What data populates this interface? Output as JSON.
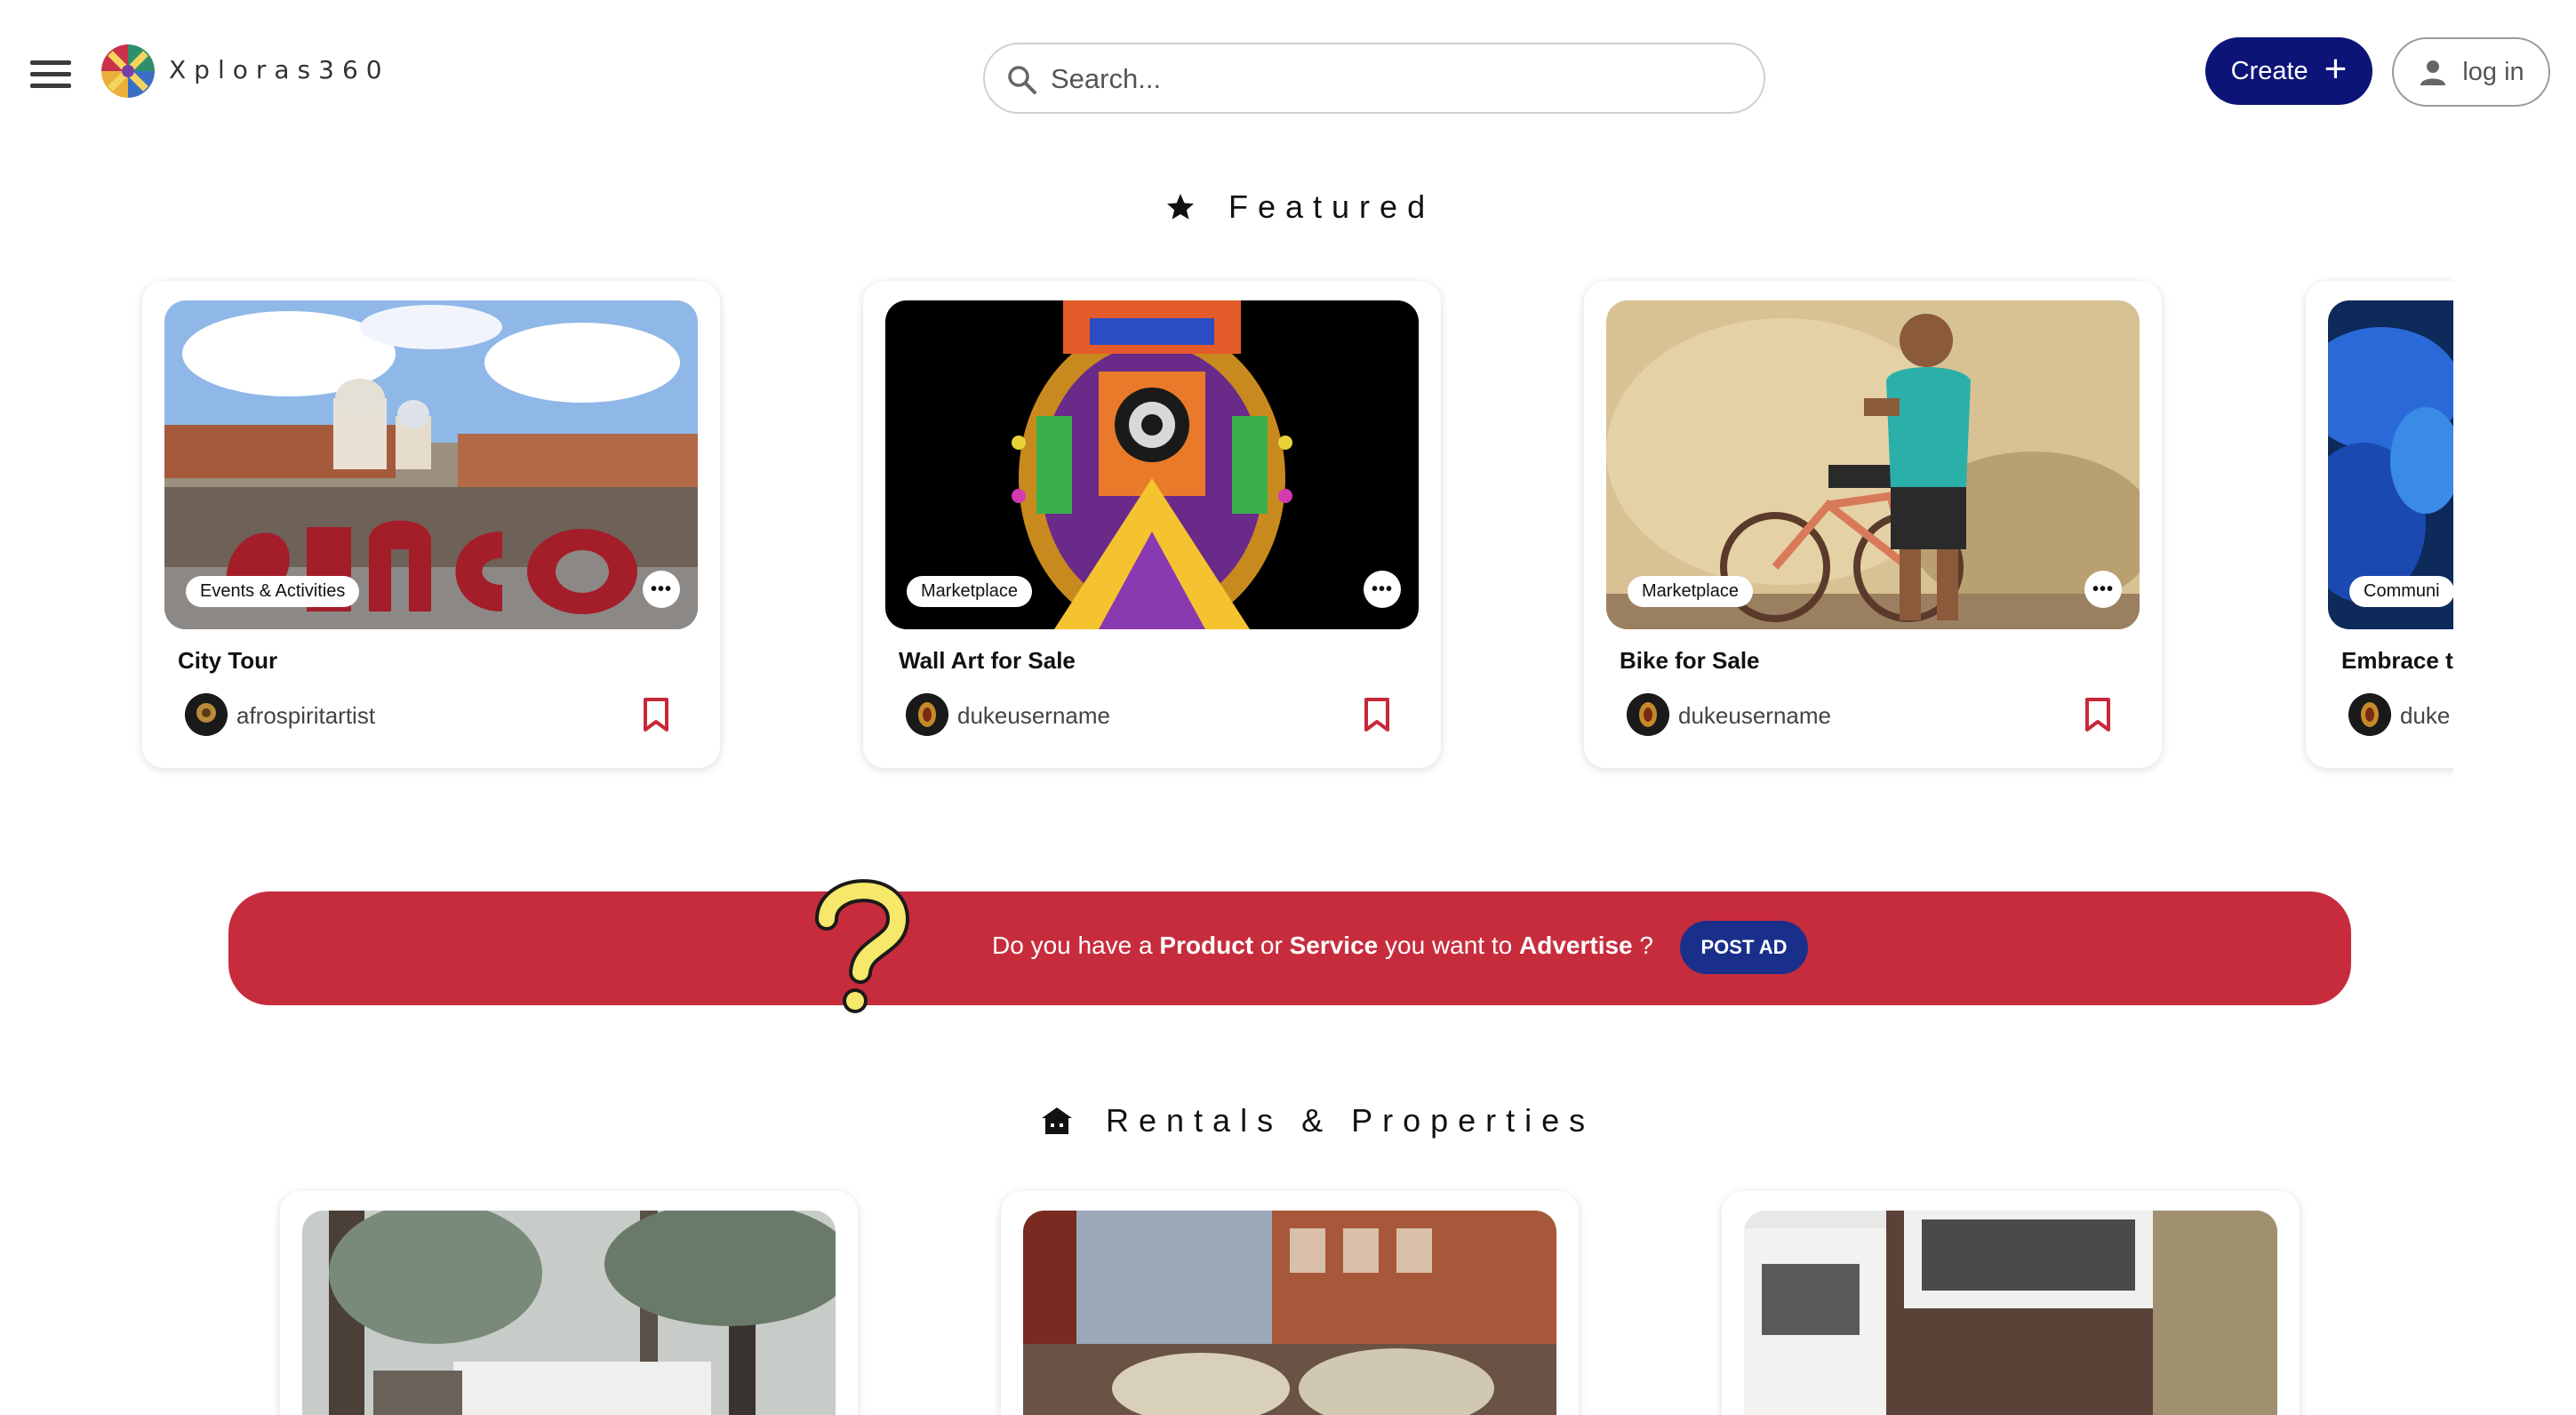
{
  "header": {
    "brand": "Xploras360",
    "search_placeholder": "Search...",
    "create_label": "Create",
    "login_label": "log in"
  },
  "featured": {
    "title": "Featured",
    "cards": [
      {
        "category": "Events & Activities",
        "title": "City Tour",
        "username": "afrospiritartist"
      },
      {
        "category": "Marketplace",
        "title": "Wall Art for Sale",
        "username": "dukeusername"
      },
      {
        "category": "Marketplace",
        "title": "Bike for Sale",
        "username": "dukeusername"
      },
      {
        "category": "Communi",
        "title": "Embrace t",
        "username": "duke"
      }
    ]
  },
  "ad": {
    "prefix": "Do you have a ",
    "product": "Product",
    "or": " or ",
    "service": "Service",
    "middle": " you want to ",
    "advertise": "Advertise",
    "suffix": " ?",
    "button_label": "POST AD"
  },
  "rentals": {
    "title": "Rentals & Properties"
  },
  "colors": {
    "primary": "#0d1478",
    "banner": "#c72c3d",
    "post_ad": "#1a2f8a",
    "bookmark": "#c7283a"
  },
  "icons": {
    "menu": "menu-icon",
    "search": "search-icon",
    "plus": "plus-icon",
    "user": "user-icon",
    "featured": "star-icon",
    "rentals": "house-icon",
    "more": "more-icon",
    "bookmark": "bookmark-icon"
  }
}
